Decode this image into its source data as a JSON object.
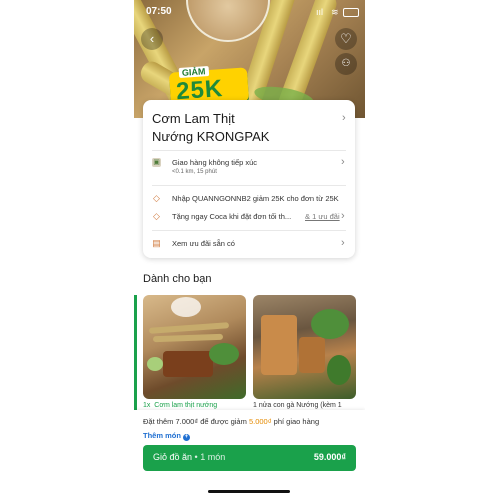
{
  "status_bar": {
    "time": "07:50",
    "signal": "ııl",
    "wifi": "≋"
  },
  "promo": {
    "small": "GIẢM",
    "big": "25K"
  },
  "store": {
    "name_line1": "Cơm Lam Thịt",
    "name_line2": "Nướng KRONGPAK"
  },
  "delivery": {
    "title": "Giao hàng không tiếp xúc",
    "sub": "<0.1 km, 15 phút"
  },
  "offers": [
    {
      "text": "Nhập QUANNGONNB2 giảm 25K cho đơn từ 25K"
    },
    {
      "text": "Tặng ngay Coca khi đặt đơn tối th...",
      "link": "& 1 ưu đãi"
    }
  ],
  "see_offers": "Xem ưu đãi sẵn có",
  "section_title": "Dành cho bạn",
  "dishes": [
    {
      "qty": "1x",
      "name": "Cơm lam thịt nướng"
    },
    {
      "name": "1 nửa con gà Nướng (kèm 1"
    }
  ],
  "cart_bar": {
    "message_prefix": "Đặt thêm 7.000₫ để được giảm",
    "message_highlight": "5.000₫",
    "message_suffix": "phí giao hàng",
    "add_more": "Thêm món",
    "cart_label": "Giỏ đồ ăn",
    "cart_count": "• 1 món",
    "total": "59.000₫"
  },
  "colors": {
    "brand": "#1aa14b",
    "highlight": "#e58a00",
    "link": "#1f6fd1"
  }
}
